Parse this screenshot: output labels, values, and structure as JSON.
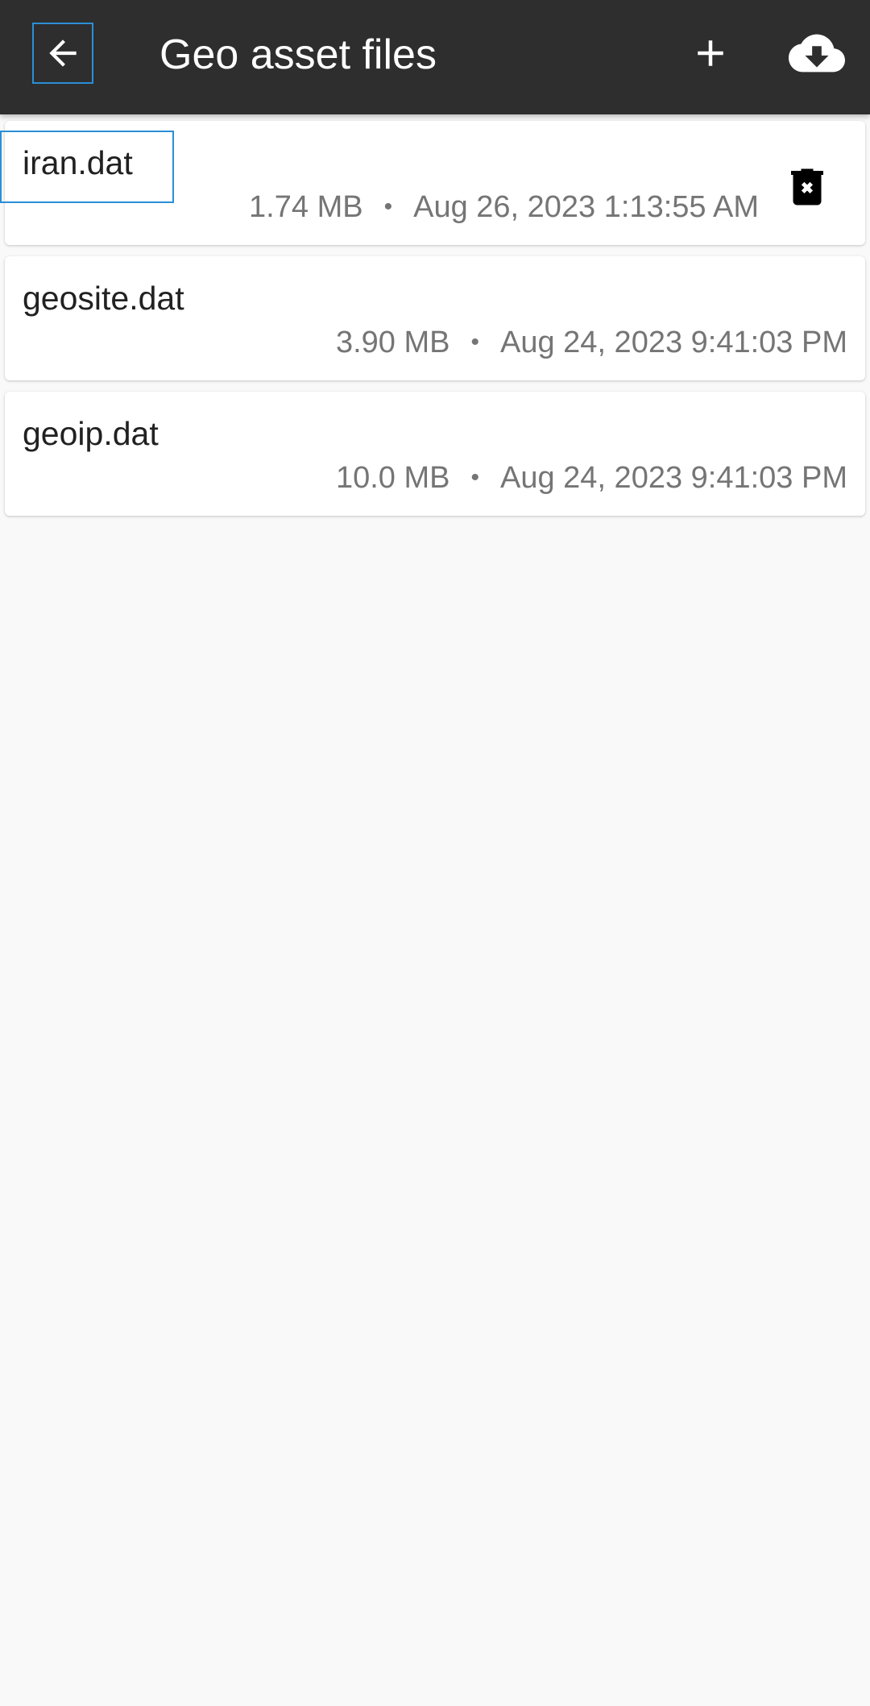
{
  "app_bar": {
    "title": "Geo asset files",
    "back_icon": "arrow-left-icon",
    "add_icon": "plus-icon",
    "download_icon": "cloud-download-icon",
    "background": "#2e2e2e"
  },
  "files": [
    {
      "name": "iran.dat",
      "size": "1.74 MB",
      "separator": "•",
      "date": "Aug 26, 2023 1:13:55 AM",
      "deletable": true,
      "delete_icon": "trash-x-icon"
    },
    {
      "name": "geosite.dat",
      "size": "3.90 MB",
      "separator": "•",
      "date": "Aug 24, 2023 9:41:03 PM"
    },
    {
      "name": "geoip.dat",
      "size": "10.0 MB",
      "separator": "•",
      "date": "Aug 24, 2023 9:41:03 PM"
    }
  ],
  "colors": {
    "focus_outline": "#2b8fd6",
    "page_background": "#f9f9f9"
  }
}
